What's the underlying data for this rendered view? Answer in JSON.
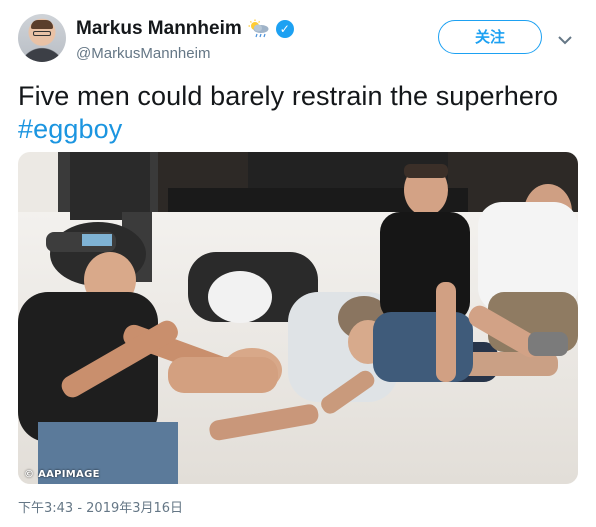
{
  "author": {
    "display_name": "Markus Mannheim",
    "handle": "@MarkusMannheim",
    "badge_icons": [
      "weather-sun-cloud-rain-icon",
      "verified-badge-icon"
    ]
  },
  "follow_button": {
    "label": "关注"
  },
  "tweet": {
    "text": "Five men could barely restrain the superhero",
    "hashtag": "#eggboy"
  },
  "media": {
    "watermark": "© AAPIMAGE"
  },
  "timestamp": "下午3:43 - 2019年3月16日",
  "colors": {
    "accent": "#1da1f2",
    "hashtag": "#1b95e0",
    "secondary_text": "#657786"
  }
}
